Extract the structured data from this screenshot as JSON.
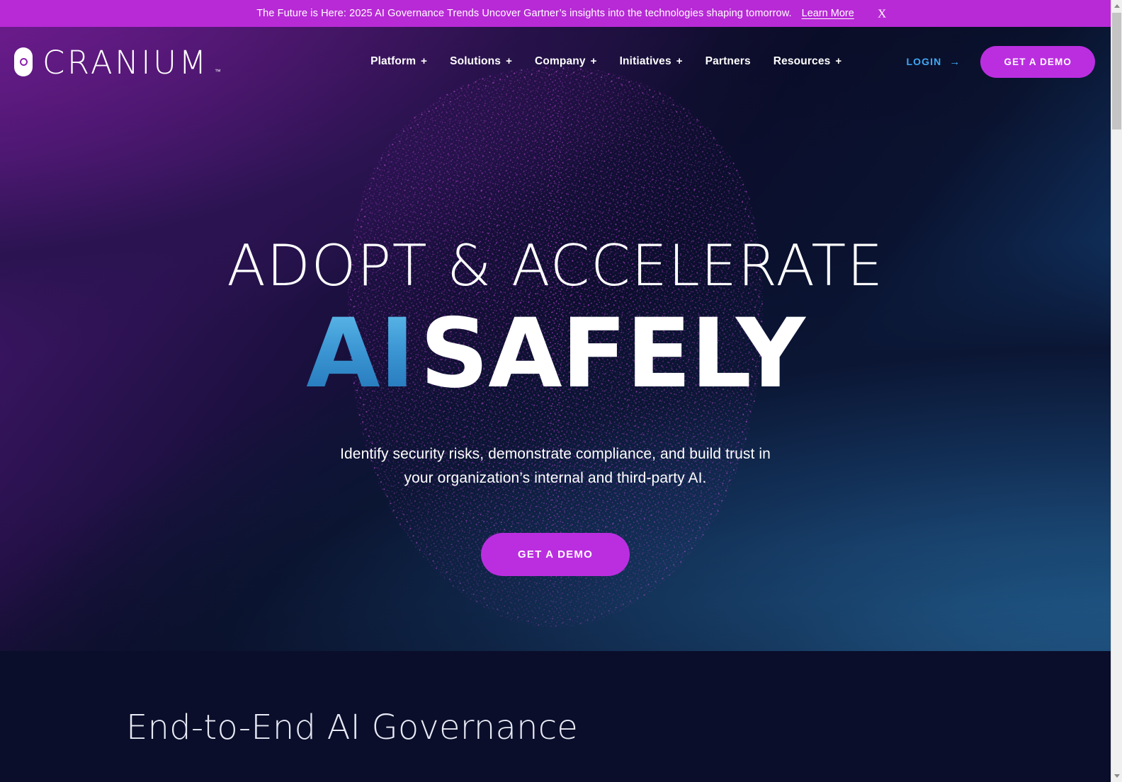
{
  "announcement": {
    "text": "The Future is Here: 2025 AI Governance Trends Uncover Gartner’s insights into the technologies shaping tomorrow.",
    "link_label": "Learn More",
    "close_label": "X",
    "background": "#b82ad6"
  },
  "nav": {
    "logo_word": "CRANIUM",
    "logo_tm": "™",
    "items": [
      {
        "label": "Platform",
        "has_submenu": true,
        "plus": "+"
      },
      {
        "label": "Solutions",
        "has_submenu": true,
        "plus": "+"
      },
      {
        "label": "Company",
        "has_submenu": true,
        "plus": "+"
      },
      {
        "label": "Initiatives",
        "has_submenu": true,
        "plus": "+"
      },
      {
        "label": "Partners",
        "has_submenu": false,
        "plus": ""
      },
      {
        "label": "Resources",
        "has_submenu": true,
        "plus": "+"
      }
    ],
    "login_label": "LOGIN",
    "login_arrow": "→",
    "login_color": "#3fa9f5",
    "demo_label": "GET A DEMO",
    "demo_color": "#bb2ee0"
  },
  "hero": {
    "headline_line1": "ADOPT & ACCELERATE",
    "headline_ai": "AI",
    "headline_safely": "SAFELY",
    "ai_gradient_from": "#66c3ee",
    "ai_gradient_to": "#1f6bad",
    "subtitle": "Identify security risks, demonstrate compliance, and build trust in your organization’s internal and third-party AI.",
    "cta_label": "GET A DEMO",
    "cta_color": "#bb2ee0",
    "background_top_left": "#7b1fa2",
    "background_bottom_right": "#3f9ad6",
    "background_mid": "#0b0e2c",
    "particle_color": "#c23be0"
  },
  "section_governance": {
    "title": "End-to-End AI Governance",
    "background": "#0a0e2a"
  },
  "scrollbar": {
    "up_arrow": "▲",
    "down_arrow": "▼"
  }
}
